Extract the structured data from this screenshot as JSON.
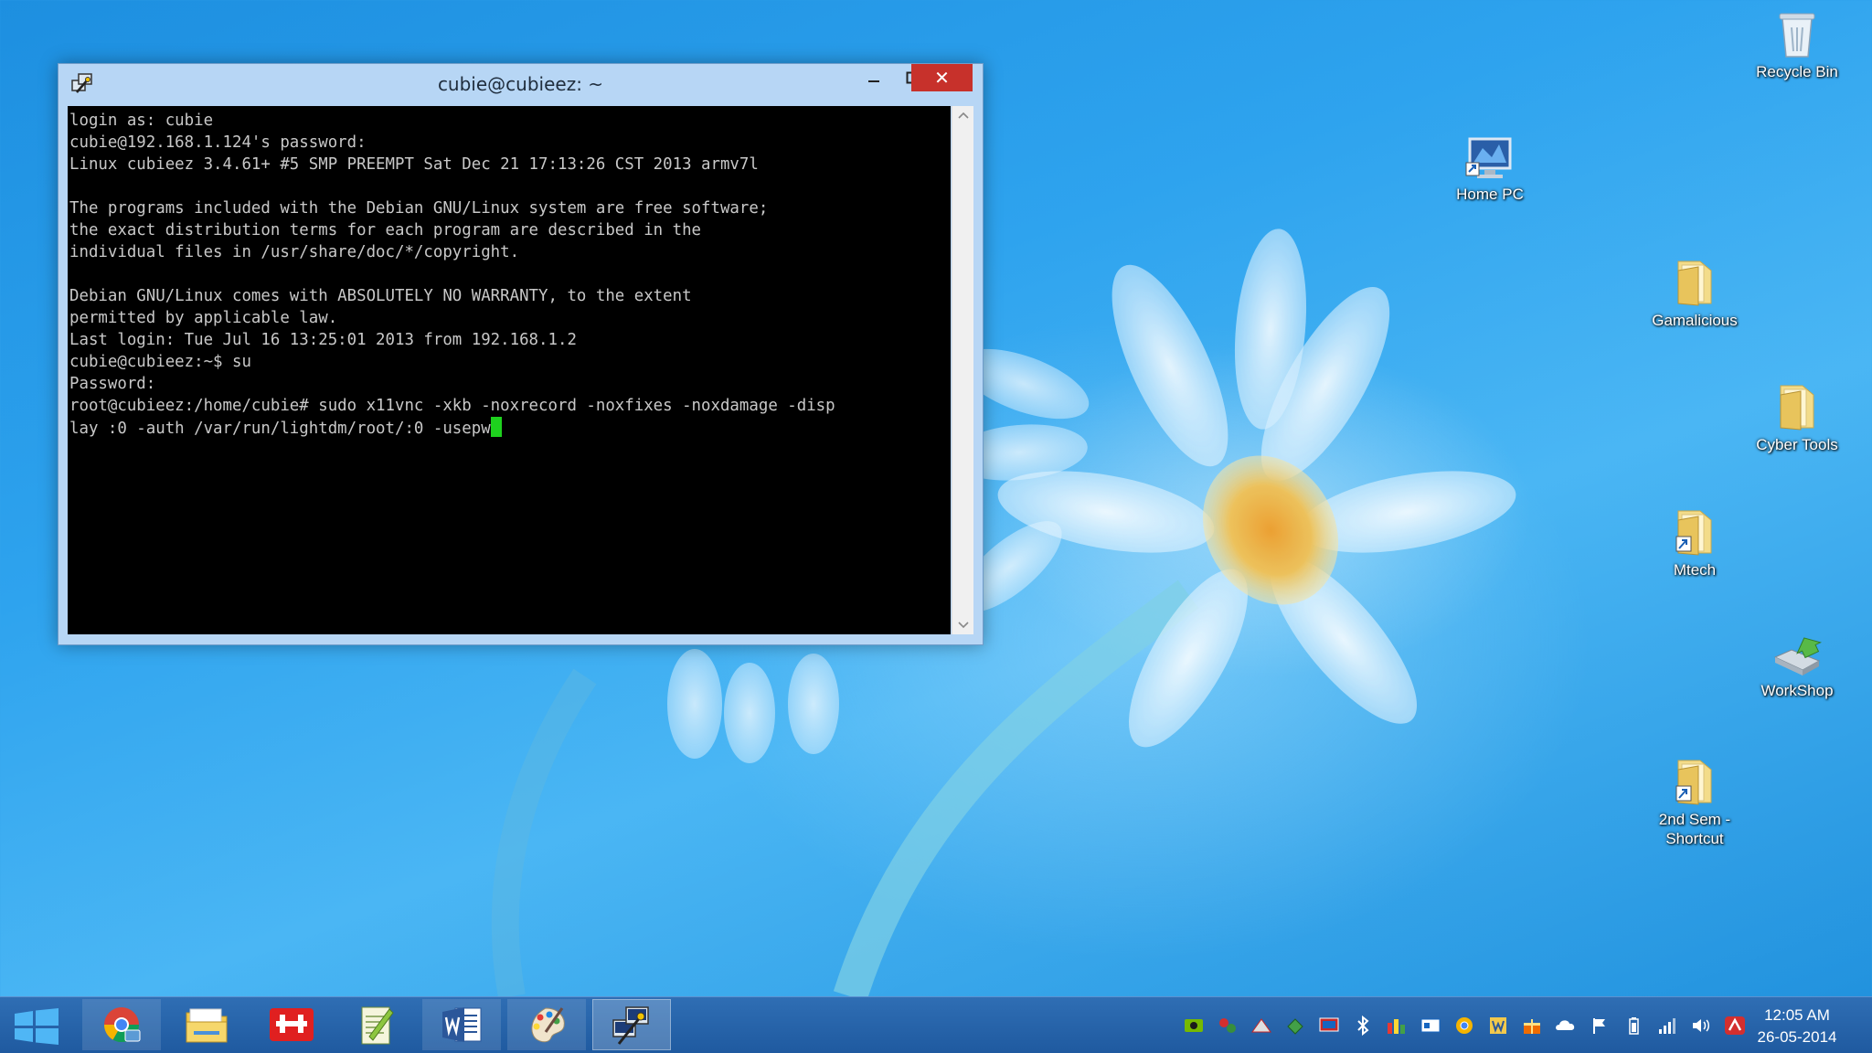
{
  "window": {
    "title": "cubie@cubieez: ~",
    "close_symbol": "✕"
  },
  "terminal": {
    "lines": [
      "login as: cubie",
      "cubie@192.168.1.124's password:",
      "Linux cubieez 3.4.61+ #5 SMP PREEMPT Sat Dec 21 17:13:26 CST 2013 armv7l",
      "",
      "The programs included with the Debian GNU/Linux system are free software;",
      "the exact distribution terms for each program are described in the",
      "individual files in /usr/share/doc/*/copyright.",
      "",
      "Debian GNU/Linux comes with ABSOLUTELY NO WARRANTY, to the extent",
      "permitted by applicable law.",
      "Last login: Tue Jul 16 13:25:01 2013 from 192.168.1.2",
      "cubie@cubieez:~$ su",
      "Password:",
      "root@cubieez:/home/cubie# sudo x11vnc -xkb -noxrecord -noxfixes -noxdamage -disp",
      "lay :0 -auth /var/run/lightdm/root/:0 -usepw"
    ],
    "cursor_color": "#1ed11e"
  },
  "desktop": {
    "recycle_bin": "Recycle Bin",
    "home_pc": "Home PC",
    "gamalicious": "Gamalicious",
    "cyber_tools": "Cyber Tools",
    "mtech": "Mtech",
    "workshop": "WorkShop",
    "second_sem_line1": "2nd Sem -",
    "second_sem_line2": "Shortcut"
  },
  "taskbar": {
    "apps": [
      "chrome-icon",
      "file-explorer-icon",
      "pdf-tool-icon",
      "notepad-plus-icon",
      "word-icon",
      "paint-icon",
      "putty-icon"
    ],
    "tray_icons": [
      "nvidia-icon",
      "network-tool-icon",
      "tray-app-icon",
      "tray-app-icon",
      "display-icon",
      "bluetooth-icon",
      "bars-app-icon",
      "card-icon",
      "chrome-tray-icon",
      "word-tray-icon",
      "gift-icon",
      "cloud-icon",
      "flag-icon",
      "battery-icon",
      "signal-icon",
      "volume-icon",
      "antivirus-icon"
    ],
    "time": "12:05 AM",
    "date": "26-05-2014"
  },
  "colors": {
    "accent": "#1e8fdc",
    "close_button": "#c7312b",
    "taskbar": "#2563a8"
  }
}
